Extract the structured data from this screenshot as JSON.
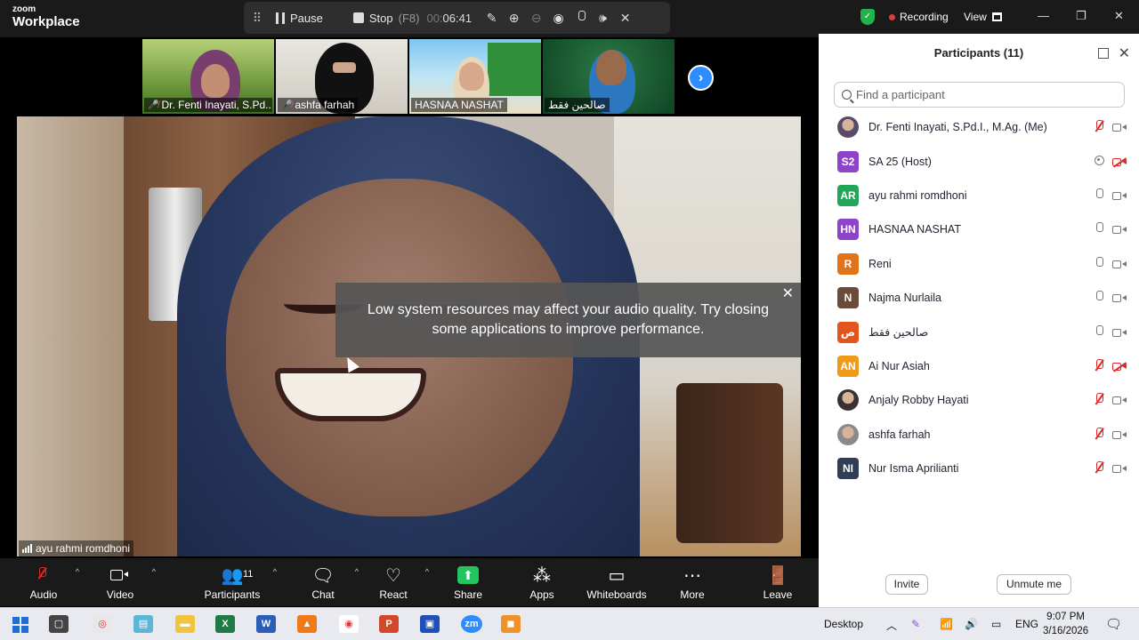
{
  "app": {
    "logo_line1": "zoom",
    "logo_line2": "Workplace"
  },
  "recording_bar": {
    "grip": "⠿",
    "pause_label": "Pause",
    "stop_label": "Stop",
    "stop_key": "(F8)",
    "timer_dim": "00:",
    "timer": "06:41",
    "icons": [
      "pencil-icon",
      "zoom-in-icon",
      "zoom-out-icon",
      "eye-icon",
      "mic-icon",
      "speaker-icon",
      "close-icon"
    ]
  },
  "window_bar": {
    "recording_label": "Recording",
    "view_label": "View",
    "minimize": "—",
    "maximize": "❐",
    "close": "✕"
  },
  "thumbnails": [
    {
      "name": "Dr. Fenti Inayati, S.Pd....",
      "muted": true
    },
    {
      "name": "ashfa farhah",
      "muted": true
    },
    {
      "name": "HASNAA NASHAT",
      "muted": false
    },
    {
      "name": "صالحين فقط",
      "muted": false
    }
  ],
  "next_arrow": "›",
  "main_video": {
    "participant_name": "ayu rahmi romdhoni"
  },
  "toast": {
    "message_line1": "Low system resources may affect your audio quality. Try closing",
    "message_line2": "some applications to improve performance.",
    "close": "✕"
  },
  "toolbar": {
    "audio": "Audio",
    "video": "Video",
    "participants": "Participants",
    "participants_count": "11",
    "chat": "Chat",
    "react": "React",
    "share": "Share",
    "apps": "Apps",
    "whiteboards": "Whiteboards",
    "more": "More",
    "leave": "Leave",
    "caret": "^"
  },
  "panel": {
    "title": "Participants (11)",
    "search_placeholder": "Find a participant",
    "invite": "Invite",
    "unmute_me": "Unmute me",
    "participants": [
      {
        "initials": "",
        "name": "Dr. Fenti Inayati, S.Pd.I., M.Ag. (Me)",
        "color": "#5a4a6a",
        "photo": true,
        "mic": "muted",
        "cam": "on"
      },
      {
        "initials": "S2",
        "name": "SA 25 (Host)",
        "color": "#8e44c9",
        "photo": false,
        "mic": "host",
        "cam": "off"
      },
      {
        "initials": "AR",
        "name": "ayu rahmi romdhoni",
        "color": "#23a559",
        "photo": false,
        "mic": "on",
        "cam": "on"
      },
      {
        "initials": "HN",
        "name": "HASNAA NASHAT",
        "color": "#8e44c9",
        "photo": false,
        "mic": "on",
        "cam": "on"
      },
      {
        "initials": "R",
        "name": "Reni",
        "color": "#e1741a",
        "photo": false,
        "mic": "on",
        "cam": "on"
      },
      {
        "initials": "N",
        "name": "Najma Nurlaila",
        "color": "#6b4c3b",
        "photo": false,
        "mic": "on",
        "cam": "on"
      },
      {
        "initials": "ص",
        "name": "صالحين فقط",
        "color": "#e2551c",
        "photo": false,
        "mic": "on",
        "cam": "on"
      },
      {
        "initials": "AN",
        "name": "Ai Nur Asiah",
        "color": "#f09a1a",
        "photo": false,
        "mic": "muted",
        "cam": "off"
      },
      {
        "initials": "",
        "name": "Anjaly Robby Hayati",
        "color": "#3a3030",
        "photo": true,
        "mic": "muted",
        "cam": "on"
      },
      {
        "initials": "",
        "name": "ashfa farhah",
        "color": "#8a8a8a",
        "photo": true,
        "mic": "muted",
        "cam": "on"
      },
      {
        "initials": "NI",
        "name": "Nur Isma Aprilianti",
        "color": "#2f3e55",
        "photo": false,
        "mic": "muted",
        "cam": "on"
      }
    ]
  },
  "taskbar": {
    "desktop_label": "Desktop",
    "lang": "ENG",
    "time": "9:07 PM",
    "date": "3/16/2026",
    "apps": [
      "task-view-icon",
      "snip-icon",
      "notepad-icon",
      "file-explorer-icon",
      "excel-icon",
      "word-icon",
      "vlc-icon",
      "chrome-icon",
      "powerpoint-icon",
      "zoom-recorder-icon",
      "zoom-icon",
      "sublime-icon"
    ]
  }
}
